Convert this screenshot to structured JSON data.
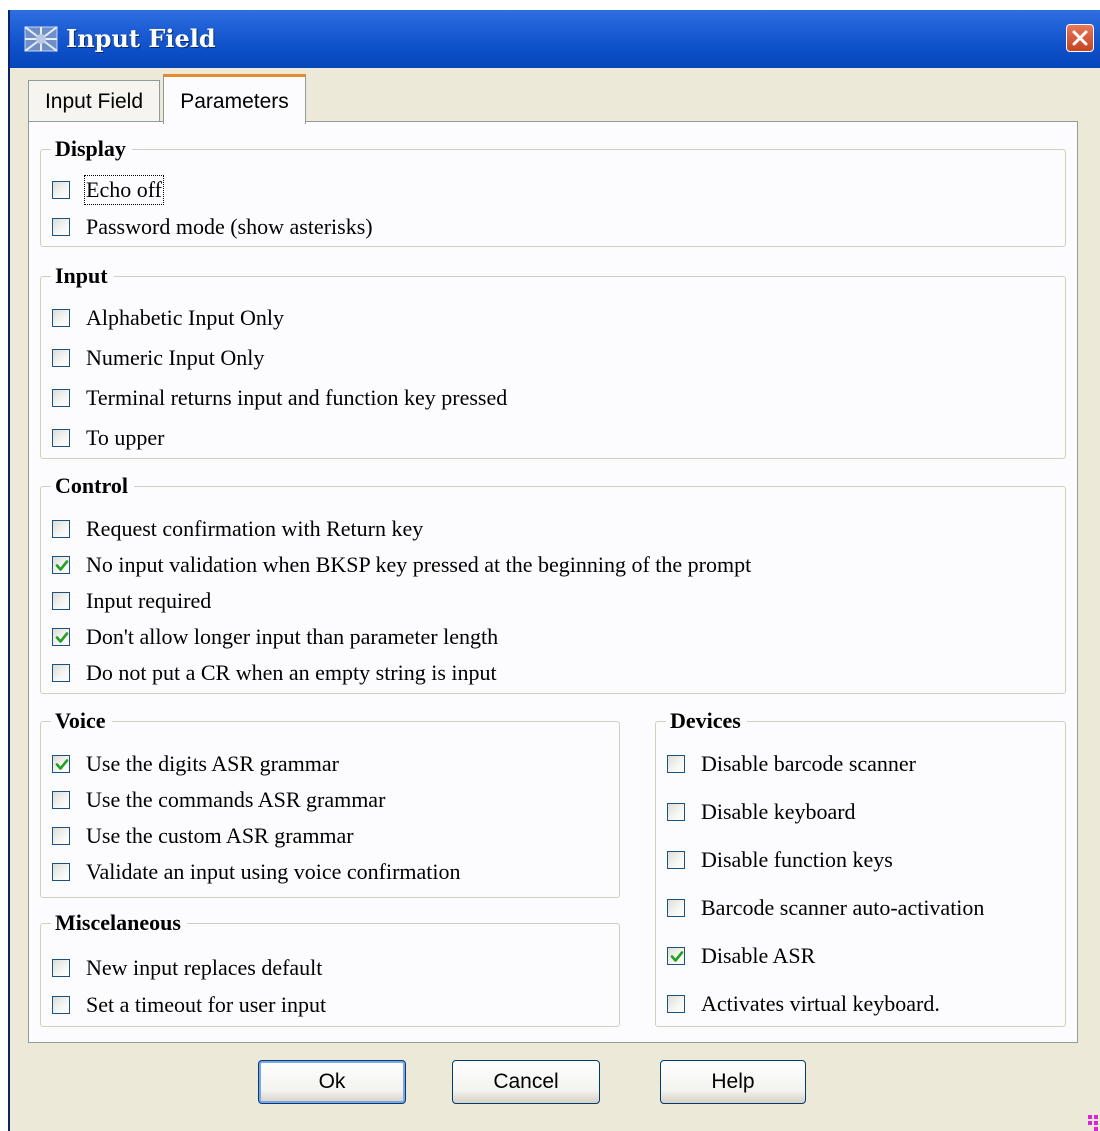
{
  "window": {
    "title": "Input Field"
  },
  "tabs": [
    {
      "label": "Input Field",
      "active": false
    },
    {
      "label": "Parameters",
      "active": true
    }
  ],
  "groups": {
    "display": {
      "title": "Display",
      "items": [
        {
          "label": "Echo off",
          "checked": false
        },
        {
          "label": "Password mode (show asterisks)",
          "checked": false
        }
      ]
    },
    "input": {
      "title": "Input",
      "items": [
        {
          "label": "Alphabetic Input Only",
          "checked": false
        },
        {
          "label": "Numeric Input Only",
          "checked": false
        },
        {
          "label": "Terminal returns input and function key pressed",
          "checked": false
        },
        {
          "label": "To upper",
          "checked": false
        }
      ]
    },
    "control": {
      "title": "Control",
      "items": [
        {
          "label": "Request confirmation with Return key",
          "checked": false
        },
        {
          "label": "No input validation when BKSP key pressed at the beginning of the prompt",
          "checked": true
        },
        {
          "label": "Input required",
          "checked": false
        },
        {
          "label": "Don't allow longer input than parameter length",
          "checked": true
        },
        {
          "label": "Do not put a CR when an empty string is input",
          "checked": false
        }
      ]
    },
    "voice": {
      "title": "Voice",
      "items": [
        {
          "label": "Use the digits ASR grammar",
          "checked": true
        },
        {
          "label": "Use the commands ASR grammar",
          "checked": false
        },
        {
          "label": "Use the custom ASR grammar",
          "checked": false
        },
        {
          "label": "Validate an input using voice confirmation",
          "checked": false
        }
      ]
    },
    "misc": {
      "title": "Miscelaneous",
      "items": [
        {
          "label": "New input replaces default",
          "checked": false
        },
        {
          "label": "Set a timeout for user input",
          "checked": false
        }
      ]
    },
    "devices": {
      "title": "Devices",
      "items": [
        {
          "label": "Disable barcode scanner",
          "checked": false
        },
        {
          "label": "Disable keyboard",
          "checked": false
        },
        {
          "label": "Disable function keys",
          "checked": false
        },
        {
          "label": "Barcode scanner auto-activation",
          "checked": false
        },
        {
          "label": "Disable ASR",
          "checked": true
        },
        {
          "label": "Activates virtual keyboard.",
          "checked": false
        }
      ]
    }
  },
  "buttons": {
    "ok": "Ok",
    "cancel": "Cancel",
    "help": "Help"
  },
  "colors": {
    "titlebar": "#0d4fc8",
    "dialog_bg": "#ece9d8",
    "check": "#21a121",
    "tab_highlight": "#e68b2c"
  }
}
